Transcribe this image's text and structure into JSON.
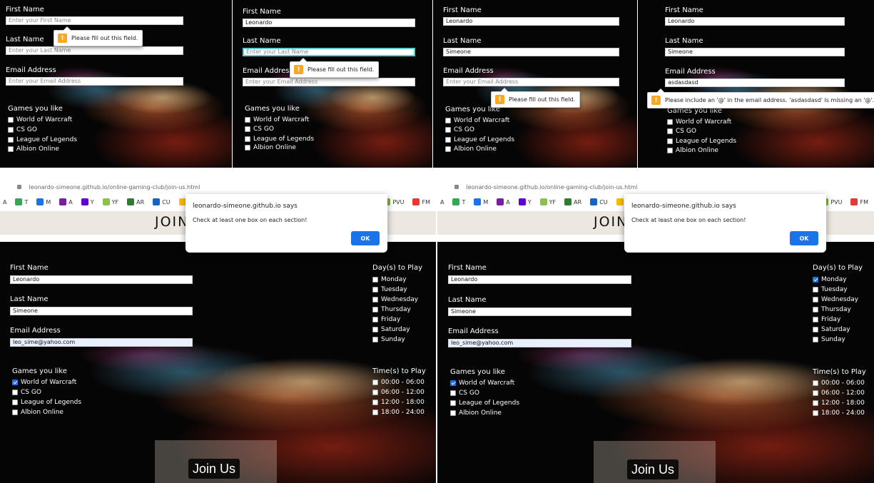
{
  "form": {
    "first_name_label": "First Name",
    "first_name_placeholder": "Enter your First Name",
    "last_name_label": "Last Name",
    "last_name_placeholder": "Enter your Last Name",
    "email_label": "Email Address",
    "email_placeholder": "Enter your Email Address",
    "first_name_value": "Leonardo",
    "last_name_value": "Simeone",
    "invalid_email_value": "asdasdasd",
    "email_value": "leo_sime@yahoo.com",
    "games_label": "Games you like",
    "games": [
      "World of Warcraft",
      "CS GO",
      "League of Legends",
      "Albion Online"
    ],
    "days_label": "Day(s) to Play",
    "days": [
      "Monday",
      "Tuesday",
      "Wednesday",
      "Thursday",
      "Friday",
      "Saturday",
      "Sunday"
    ],
    "times_label": "Time(s) to Play",
    "times": [
      "00:00 - 06:00",
      "06:00 - 12:00",
      "12:00 - 18:00",
      "18:00 - 24:00"
    ],
    "join_button": "Join Us"
  },
  "validation": {
    "fill_field": "Please fill out this field.",
    "email_missing_at": "Please include an '@' in the email address. 'asdasdasd' is missing an '@'.",
    "warn_icon": "!"
  },
  "browser": {
    "url": "leonardo-simeone.github.io/online-gaming-club/join-us.html",
    "bookmarks": [
      {
        "icon": "A",
        "color": "#555555",
        "label": ""
      },
      {
        "icon": "T",
        "color": "#34a853",
        "label": "T"
      },
      {
        "icon": "M",
        "color": "#1a73e8",
        "label": "M"
      },
      {
        "icon": "A",
        "color": "#7b1fa2",
        "label": "A"
      },
      {
        "icon": "Y",
        "color": "#6001d2",
        "label": "Y"
      },
      {
        "icon": "YF",
        "color": "#8bc34a",
        "label": "YF"
      },
      {
        "icon": "AR",
        "color": "#2e7d32",
        "label": "AR"
      },
      {
        "icon": "CU",
        "color": "#1565c0",
        "label": "CU"
      },
      {
        "icon": "G",
        "color": "#fbbc05",
        "label": ""
      }
    ],
    "bookmarks_right": [
      {
        "icon": "P",
        "color": "#7cb342",
        "label": "PVU"
      },
      {
        "icon": "F",
        "color": "#e53935",
        "label": "FM"
      }
    ]
  },
  "page": {
    "title": "JOIN"
  },
  "dialog": {
    "title": "leonardo-simeone.github.io says",
    "message": "Check at least one box on each section!",
    "ok": "OK"
  }
}
